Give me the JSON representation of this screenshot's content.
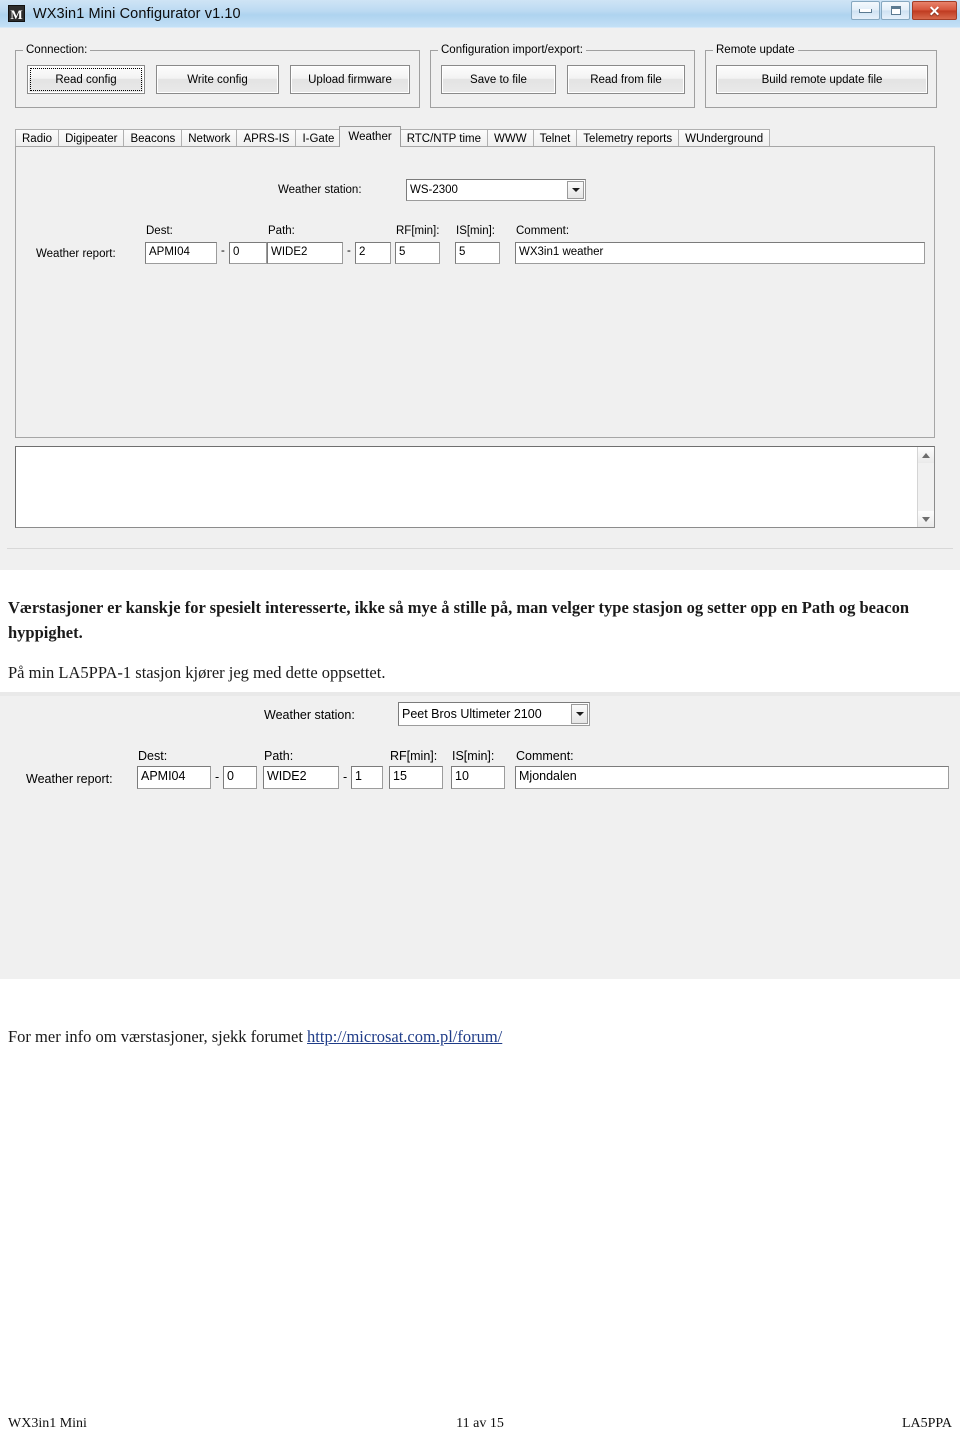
{
  "window": {
    "title": "WX3in1 Mini Configurator v1.10",
    "app_icon_letter": "M",
    "controls": {
      "minimize": "minimize-icon",
      "maximize": "maximize-icon",
      "close": "✕"
    }
  },
  "toolbar": {
    "connection": {
      "legend": "Connection:",
      "read_config": "Read config",
      "write_config": "Write config",
      "upload_firmware": "Upload firmware"
    },
    "import_export": {
      "legend": "Configuration import/export:",
      "save_to_file": "Save to file",
      "read_from_file": "Read from file"
    },
    "remote_update": {
      "legend": "Remote update",
      "build_remote_update_file": "Build remote update file"
    }
  },
  "tabs": [
    {
      "label": "Radio",
      "active": false
    },
    {
      "label": "Digipeater",
      "active": false
    },
    {
      "label": "Beacons",
      "active": false
    },
    {
      "label": "Network",
      "active": false
    },
    {
      "label": "APRS-IS",
      "active": false
    },
    {
      "label": "I-Gate",
      "active": false
    },
    {
      "label": "Weather",
      "active": true
    },
    {
      "label": "RTC/NTP time",
      "active": false
    },
    {
      "label": "WWW",
      "active": false
    },
    {
      "label": "Telnet",
      "active": false
    },
    {
      "label": "Telemetry reports",
      "active": false
    },
    {
      "label": "WUnderground",
      "active": false
    }
  ],
  "weather_tab": {
    "station_label": "Weather station:",
    "station_value": "WS-2300",
    "report_label": "Weather report:",
    "dest_label": "Dest:",
    "dest_value": "APMI04",
    "dest_ssid": "0",
    "path_label": "Path:",
    "path_value": "WIDE2",
    "path_ssid": "2",
    "rf_label": "RF[min]:",
    "rf_value": "5",
    "is_label": "IS[min]:",
    "is_value": "5",
    "comment_label": "Comment:",
    "comment_value": "WX3in1 weather",
    "separator": "-"
  },
  "log": {
    "content": ""
  },
  "body_text": {
    "paragraph1": "Værstasjoner er kanskje for spesielt interesserte, ikke så mye å stille på, man velger type stasjon og setter opp en Path og beacon hyppighet.",
    "paragraph2": "På min LA5PPA-1 stasjon kjører jeg med dette oppsettet.",
    "paragraph3_prefix": "For mer info om værstasjoner, sjekk forumet",
    "paragraph3_link": "http://microsat.com.pl/forum/"
  },
  "second_screenshot": {
    "station_label": "Weather station:",
    "station_value": "Peet Bros Ultimeter 2100",
    "report_label": "Weather report:",
    "dest_label": "Dest:",
    "dest_value": "APMI04",
    "dest_ssid": "0",
    "path_label": "Path:",
    "path_value": "WIDE2",
    "path_ssid": "1",
    "rf_label": "RF[min]:",
    "rf_value": "15",
    "is_label": "IS[min]:",
    "is_value": "10",
    "comment_label": "Comment:",
    "comment_value": "Mjondalen",
    "separator": "-"
  },
  "footer": {
    "left": "WX3in1 Mini",
    "center": "11 av 15",
    "right": "LA5PPA"
  },
  "colors": {
    "titlebar_blue": "#bcdaf2",
    "close_red": "#bf3a20",
    "window_gray": "#f0f0f0",
    "link_blue": "#1f3c88"
  }
}
